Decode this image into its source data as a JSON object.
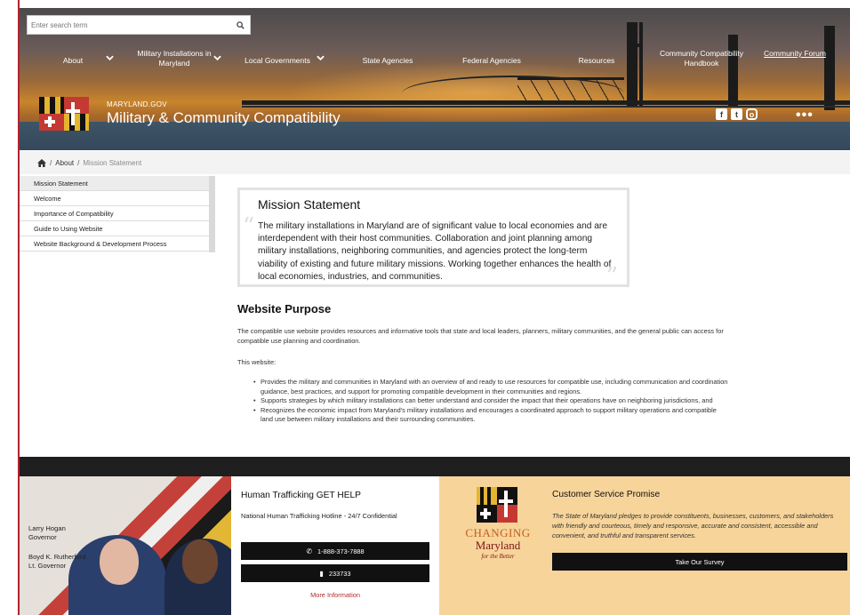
{
  "search": {
    "placeholder": "Enter search term"
  },
  "nav": {
    "items": [
      {
        "label": "About"
      },
      {
        "label": "Military Installations in Maryland"
      },
      {
        "label": "Local Governments"
      },
      {
        "label": "State Agencies"
      },
      {
        "label": "Federal Agencies"
      },
      {
        "label": "Resources"
      },
      {
        "label": "Community Compatibility Handbook"
      },
      {
        "label": "Community Forum"
      }
    ]
  },
  "brand": {
    "small": "MARYLAND.GOV",
    "title": "Military & Community Compatibility"
  },
  "social": {
    "facebook": "f",
    "twitter": "t",
    "instagram": "o",
    "more": "•••"
  },
  "breadcrumb": {
    "home": "",
    "about": "About",
    "current": "Mission Statement"
  },
  "sidebar": {
    "items": [
      {
        "label": "Mission Statement"
      },
      {
        "label": "Welcome"
      },
      {
        "label": "Importance of Compatibility"
      },
      {
        "label": "Guide to Using Website"
      },
      {
        "label": "Website Background & Development Process"
      }
    ]
  },
  "mission": {
    "title": "Mission Statement",
    "text": "The military installations in Maryland are of significant value to local economies and are interdependent with their host communities. Collaboration and joint planning among military installations, neighboring communities, and agencies protect the long-term viability of existing and future military missions. Working together enhances the health of local economies, industries, and communities."
  },
  "purpose": {
    "title": "Website Purpose",
    "paragraph": "The compatible use website provides resources and informative tools that state and local leaders, planners, military communities, and the general public can access for compatible use planning and coordination.",
    "this_website": "This website:",
    "bullets": [
      "Provides the military and communities in Maryland with an overview of and ready to use resources for compatible use, including communication and coordination guidance, best practices, and support for promoting compatible development in their communities and regions.",
      "Supports strategies by which military installations can better understand and consider the impact that their operations have on neighboring jurisdictions, and",
      "Recognizes the economic impact from Maryland's military installations and encourages a coordinated approach to support military operations and compatible land use between military installations and their surrounding communities."
    ]
  },
  "footer": {
    "governor": {
      "name1": "Larry Hogan",
      "title1": "Governor",
      "name2": "Boyd K. Rutherford",
      "title2": "Lt. Governor"
    },
    "trafficking": {
      "title": "Human Trafficking GET HELP",
      "subtitle": "National Human Trafficking Hotline - 24/7 Confidential",
      "phone": "1-888-373-7888",
      "text": "233733",
      "more": "More Information"
    },
    "changing": {
      "line1": "CHANGING",
      "line2": "Maryland",
      "line3": "for the Better"
    },
    "service": {
      "title": "Customer Service Promise",
      "text": "The State of Maryland pledges to provide constituents, businesses, customers, and stakeholders with friendly and courteous, timely and responsive, accurate and consistent, accessible and convenient, and truthful and transparent services.",
      "button": "Take Our Survey"
    }
  },
  "colors": {
    "accent": "#b0252f",
    "footer_tan": "#f7d49a",
    "dark": "#1f1f1f"
  }
}
